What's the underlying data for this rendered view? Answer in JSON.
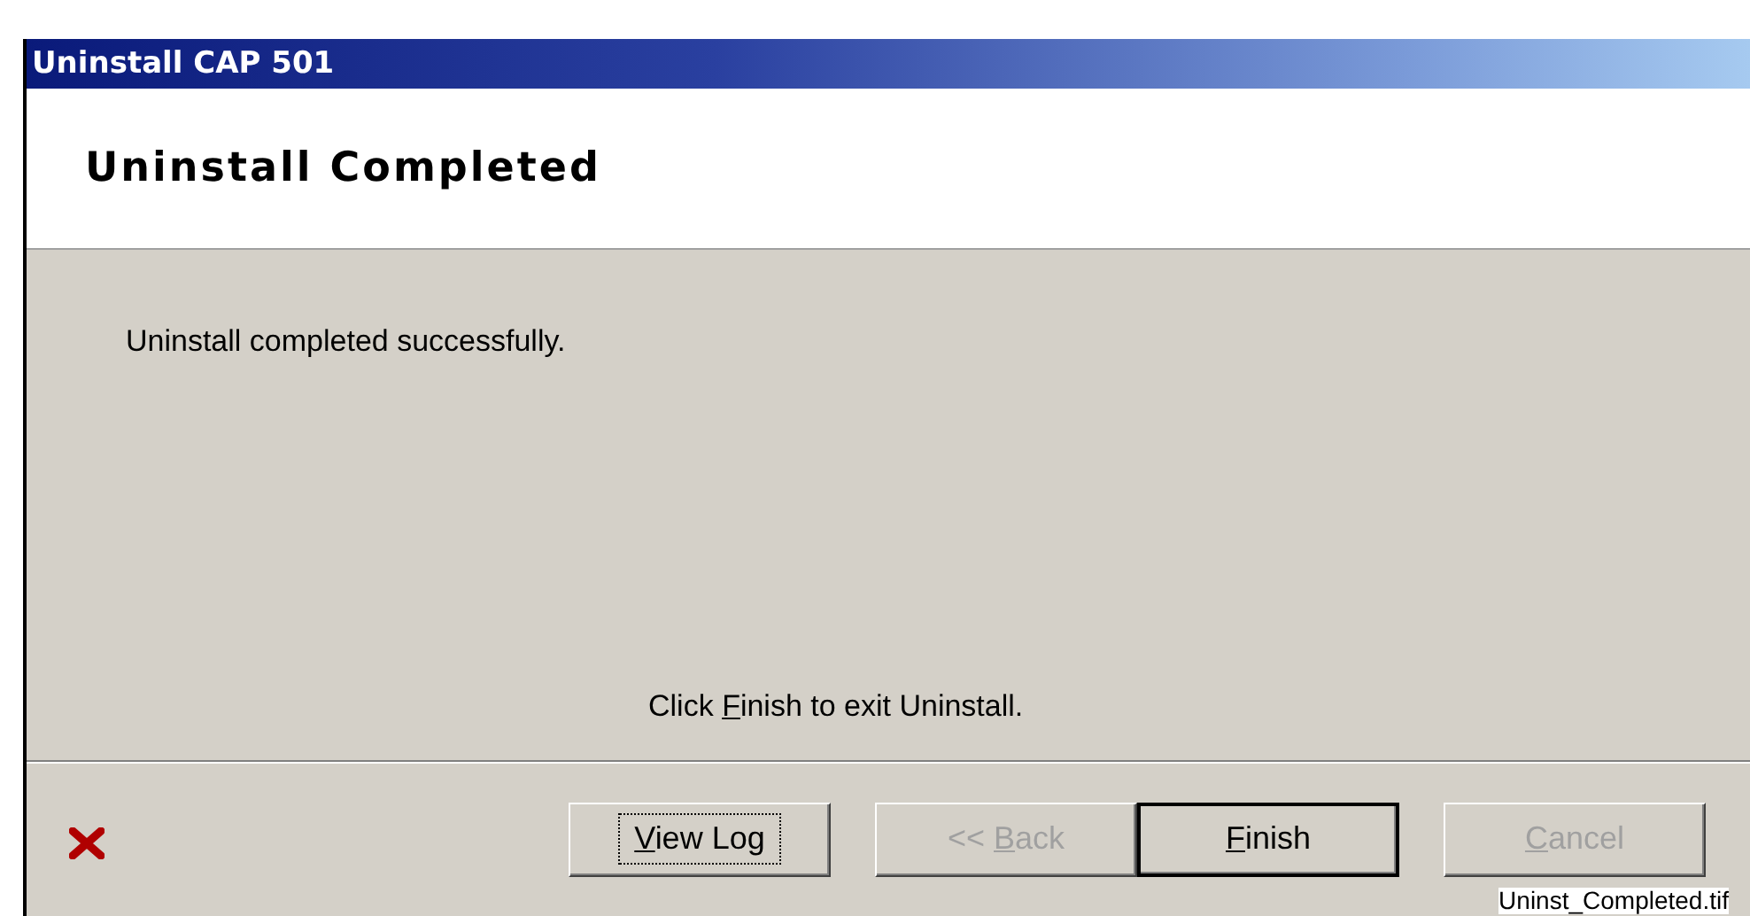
{
  "window": {
    "title": "Uninstall CAP 501"
  },
  "header": {
    "title": "Uninstall Completed"
  },
  "body": {
    "message": "Uninstall completed successfully.",
    "instruction_before": "Click ",
    "instruction_mnemonic": "F",
    "instruction_after": "inish to exit Uninstall."
  },
  "buttons": [
    {
      "mnemonic": "V",
      "rest": "iew Log",
      "disabled": false,
      "focused": true,
      "default": false
    },
    {
      "mnemonic": "B",
      "rest": "ack",
      "prefix": "<< ",
      "disabled": true,
      "focused": false,
      "default": false
    },
    {
      "mnemonic": "F",
      "rest": "inish",
      "disabled": false,
      "focused": false,
      "default": true
    },
    {
      "mnemonic": "C",
      "rest": "ancel",
      "disabled": true,
      "focused": false,
      "default": false
    }
  ],
  "caption": "Uninst_Completed.tif"
}
